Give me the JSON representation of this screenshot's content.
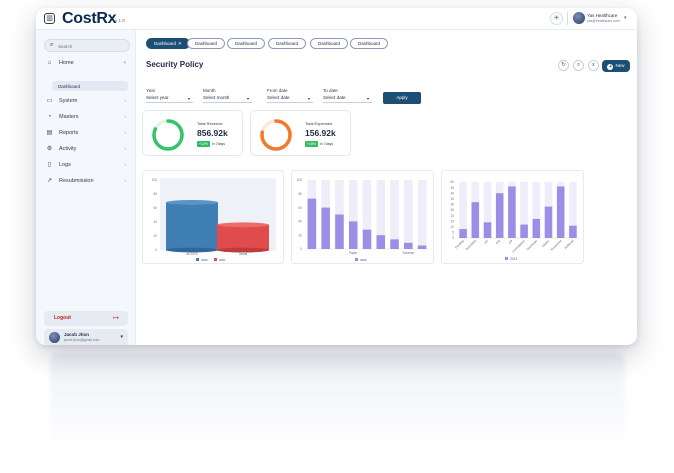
{
  "app": {
    "logo_prefix": "Cost",
    "logo_suffix": "Rx",
    "version": "v 1.0"
  },
  "header": {
    "theme_icon": "sun-icon",
    "profile_name": "Yas Healthcare",
    "profile_email": "yas@healthcare.com"
  },
  "sidebar": {
    "search_placeholder": "Search",
    "items": [
      {
        "label": "Home",
        "icon": "home-icon"
      },
      {
        "label": "System",
        "icon": "monitor-icon"
      },
      {
        "label": "Masters",
        "icon": "pie-icon"
      },
      {
        "label": "Reports",
        "icon": "file-icon"
      },
      {
        "label": "Activity",
        "icon": "gear-icon"
      },
      {
        "label": "Logs",
        "icon": "book-icon"
      },
      {
        "label": "Resubmission",
        "icon": "trend-icon"
      }
    ],
    "sub_item": "Dashboard",
    "logout_label": "Logout",
    "user": {
      "name": "Jacob Jhon",
      "email": "jacob.jhon@gmail.com"
    }
  },
  "tabs": [
    "Dashboard",
    "Dashboard",
    "Dashboard",
    "Dashboard",
    "Dashboard",
    "Dashboard"
  ],
  "page_title": "Security Policy",
  "actions": {
    "new_label": "New"
  },
  "filters": [
    {
      "label": "Year",
      "value": "Select year"
    },
    {
      "label": "Month",
      "value": "Select month"
    },
    {
      "label": "From date",
      "value": "Select date"
    },
    {
      "label": "To date",
      "value": "Select date"
    }
  ],
  "apply_label": "Apply",
  "kpis": [
    {
      "label": "Total Revenue",
      "value": "856.92k",
      "badge": "+12%",
      "period": "in 7days",
      "color": "#34c46c",
      "progress": 0.82
    },
    {
      "label": "Total Expenses",
      "value": "156.92k",
      "badge": "+15%",
      "period": "in 7days",
      "color": "#f07a2a",
      "progress": 0.78
    }
  ],
  "chart_data": [
    {
      "type": "bar",
      "categories": [
        "all 2023",
        "Jamai"
      ],
      "series": [
        {
          "name": "asan",
          "values": [
            68,
            32
          ],
          "color": "#3f7fb3"
        },
        {
          "name": "start",
          "values": [
            0,
            36
          ],
          "color": "#e04b4b"
        }
      ],
      "ylim": [
        0,
        100
      ],
      "ytick_labels": [
        "0",
        "20",
        "40",
        "60",
        "80",
        "100"
      ],
      "style": "3d-cylinder"
    },
    {
      "type": "bar",
      "categories": [
        "",
        "",
        "",
        "Payer",
        "",
        "",
        "",
        "Scheme",
        ""
      ],
      "series": [
        {
          "name": "asan",
          "values": [
            73,
            60,
            50,
            40,
            28,
            20,
            14,
            9,
            5
          ],
          "color": "#9b8ee6"
        }
      ],
      "ylim": [
        0,
        100
      ],
      "ytick_labels": [
        "0",
        "20",
        "40",
        "60",
        "80",
        "100"
      ]
    },
    {
      "type": "bar",
      "categories": [
        "Pending",
        "Submitted",
        "VIC",
        "IPD",
        "OP",
        "Consultation",
        "Discharge",
        "Claims",
        "Reopened",
        "Reffered"
      ],
      "series": [
        {
          "name": "2023",
          "values": [
            8,
            32,
            14,
            40,
            46,
            12,
            17,
            28,
            46,
            11
          ],
          "color": "#9b8ee6"
        }
      ],
      "ylim": [
        0,
        50
      ],
      "ytick_labels": [
        "0",
        "5",
        "10",
        "15",
        "20",
        "25",
        "30",
        "35",
        "40",
        "45",
        "50"
      ]
    }
  ]
}
